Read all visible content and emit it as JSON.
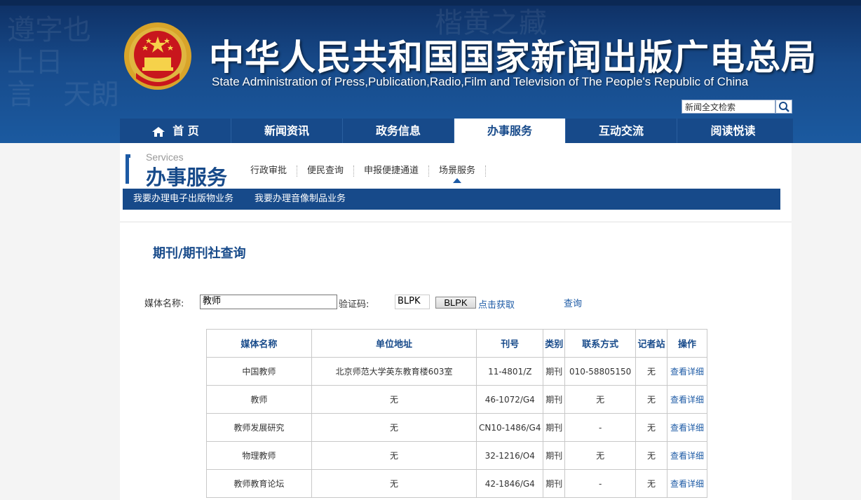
{
  "header": {
    "title_cn": "中华人民共和国国家新闻出版广电总局",
    "title_en": "State Administration of Press,Publication,Radio,Film and Television of The People's Republic of China",
    "search_placeholder": "新闻全文检索"
  },
  "nav": {
    "items": [
      {
        "label": "首 页"
      },
      {
        "label": "新闻资讯"
      },
      {
        "label": "政务信息"
      },
      {
        "label": "办事服务"
      },
      {
        "label": "互动交流"
      },
      {
        "label": "阅读悦读"
      }
    ],
    "active_index": 3
  },
  "section": {
    "en": "Services",
    "cn": "办事服务",
    "subnav": [
      "行政审批",
      "便民查询",
      "申报便捷通道",
      "场景服务"
    ],
    "bluebar": [
      "我要办理电子出版物业务",
      "我要办理音像制品业务"
    ]
  },
  "query": {
    "page_title": "期刊/期刊社查询",
    "media_label": "媒体名称:",
    "media_value": "教师",
    "captcha_label": "验证码:",
    "captcha_value": "BLPK",
    "captcha_image_text": "BLPK",
    "get_link": "点击获取",
    "submit_link": "查询"
  },
  "table": {
    "headers": [
      "媒体名称",
      "单位地址",
      "刊号",
      "类别",
      "联系方式",
      "记者站",
      "操作"
    ],
    "rows": [
      [
        "中国教师",
        "北京师范大学英东教育楼603室",
        "11-4801/Z",
        "期刊",
        "010-58805150",
        "无",
        "查看详细"
      ],
      [
        "教师",
        "无",
        "46-1072/G4",
        "期刊",
        "无",
        "无",
        "查看详细"
      ],
      [
        "教师发展研究",
        "无",
        "CN10-1486/G4",
        "期刊",
        "-",
        "无",
        "查看详细"
      ],
      [
        "物理教师",
        "无",
        "32-1216/O4",
        "期刊",
        "无",
        "无",
        "查看详细"
      ],
      [
        "教师教育论坛",
        "无",
        "42-1846/G4",
        "期刊",
        "-",
        "无",
        "查看详细"
      ]
    ]
  },
  "colors": {
    "brand_blue": "#174a8a",
    "link_blue": "#1c5aa5"
  }
}
